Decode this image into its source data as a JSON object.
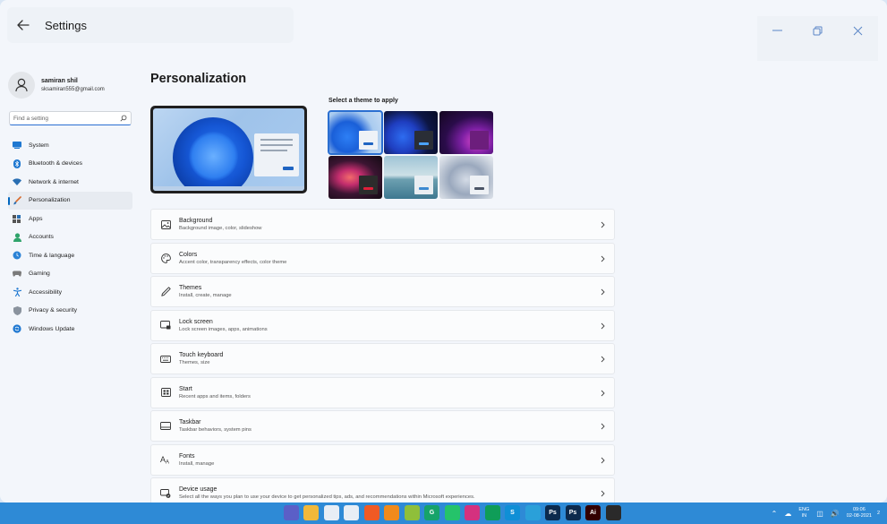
{
  "app": {
    "title": "Settings"
  },
  "profile": {
    "name": "samiran shil",
    "email": "sksamiran555@gmail.com"
  },
  "search": {
    "placeholder": "Find a setting"
  },
  "sidebar": {
    "items": [
      {
        "label": "System",
        "icon": "system-icon",
        "color": "#1f78d1"
      },
      {
        "label": "Bluetooth & devices",
        "icon": "bluetooth-icon",
        "color": "#1f78d1"
      },
      {
        "label": "Network & internet",
        "icon": "wifi-icon",
        "color": "#2a6fb3"
      },
      {
        "label": "Personalization",
        "icon": "brush-icon",
        "color": "#d86a2b",
        "active": true
      },
      {
        "label": "Apps",
        "icon": "apps-icon",
        "color": "#555"
      },
      {
        "label": "Accounts",
        "icon": "person-icon",
        "color": "#2fa36b"
      },
      {
        "label": "Time & language",
        "icon": "globe-clock-icon",
        "color": "#2a82d6"
      },
      {
        "label": "Gaming",
        "icon": "gamepad-icon",
        "color": "#6b6b6b"
      },
      {
        "label": "Accessibility",
        "icon": "accessibility-icon",
        "color": "#1f78d1"
      },
      {
        "label": "Privacy & security",
        "icon": "shield-icon",
        "color": "#7c8590"
      },
      {
        "label": "Windows Update",
        "icon": "update-icon",
        "color": "#1f78d1"
      }
    ]
  },
  "main": {
    "title": "Personalization",
    "theme_label": "Select a theme to apply",
    "themes": [
      {
        "name": "windows-light",
        "selected": true
      },
      {
        "name": "windows-dark"
      },
      {
        "name": "glow"
      },
      {
        "name": "captured-motion"
      },
      {
        "name": "sunrise"
      },
      {
        "name": "flow"
      }
    ],
    "settings": [
      {
        "title": "Background",
        "desc": "Background image, color, slideshow",
        "icon": "image-icon"
      },
      {
        "title": "Colors",
        "desc": "Accent color, transparency effects, color theme",
        "icon": "palette-icon"
      },
      {
        "title": "Themes",
        "desc": "Install, create, manage",
        "icon": "pen-icon"
      },
      {
        "title": "Lock screen",
        "desc": "Lock screen images, apps, animations",
        "icon": "lock-screen-icon"
      },
      {
        "title": "Touch keyboard",
        "desc": "Themes, size",
        "icon": "keyboard-icon"
      },
      {
        "title": "Start",
        "desc": "Recent apps and items, folders",
        "icon": "start-icon"
      },
      {
        "title": "Taskbar",
        "desc": "Taskbar behaviors, system pins",
        "icon": "taskbar-icon"
      },
      {
        "title": "Fonts",
        "desc": "Install, manage",
        "icon": "font-icon"
      },
      {
        "title": "Device usage",
        "desc": "Select all the ways you plan to use your device to get personalized tips, ads, and recommendations within Microsoft experiences.",
        "icon": "device-usage-icon"
      }
    ]
  },
  "taskbar": {
    "apps": [
      {
        "name": "windows-start-icon",
        "label": "",
        "bg": "#2e8ad6"
      },
      {
        "name": "search-icon",
        "label": "",
        "bg": "#2e8ad6"
      },
      {
        "name": "task-view-icon",
        "label": "",
        "bg": "#2e8ad6"
      },
      {
        "name": "teams-icon",
        "label": "",
        "bg": "#5b5fc7"
      },
      {
        "name": "file-explorer-icon",
        "label": "",
        "bg": "#f2b83a"
      },
      {
        "name": "paint-icon",
        "label": "",
        "bg": "#e8eef5"
      },
      {
        "name": "chrome-icon",
        "label": "",
        "bg": "#e8eef5"
      },
      {
        "name": "brave-icon",
        "label": "",
        "bg": "#f05a24"
      },
      {
        "name": "vlc-icon",
        "label": "",
        "bg": "#f08a1c"
      },
      {
        "name": "store-icon",
        "label": "",
        "bg": "#8fbf3a"
      },
      {
        "name": "grammarly-icon",
        "label": "G",
        "bg": "#16a36a"
      },
      {
        "name": "whatsapp-icon",
        "label": "",
        "bg": "#25c36a"
      },
      {
        "name": "instagram-icon",
        "label": "",
        "bg": "#d4317f"
      },
      {
        "name": "hangouts-icon",
        "label": "",
        "bg": "#0f9d58"
      },
      {
        "name": "skype-icon",
        "label": "S",
        "bg": "#0f8fd6"
      },
      {
        "name": "telegram-icon",
        "label": "",
        "bg": "#2aa0d9"
      },
      {
        "name": "photoshop-icon",
        "label": "Ps",
        "bg": "#0c2a4d"
      },
      {
        "name": "photoshop-2-icon",
        "label": "Ps",
        "bg": "#0c2a4d"
      },
      {
        "name": "illustrator-icon",
        "label": "Ai",
        "bg": "#330000"
      },
      {
        "name": "figma-icon",
        "label": "",
        "bg": "#2a2a2a"
      },
      {
        "name": "edge-icon",
        "label": "",
        "bg": "#2e8ad6"
      },
      {
        "name": "settings-gear-icon",
        "label": "",
        "bg": "#2e8ad6"
      }
    ],
    "tray": {
      "lang_top": "ENG",
      "lang_bottom": "IN",
      "time": "09:06",
      "date": "02-08-2021",
      "notifications": "2"
    }
  }
}
